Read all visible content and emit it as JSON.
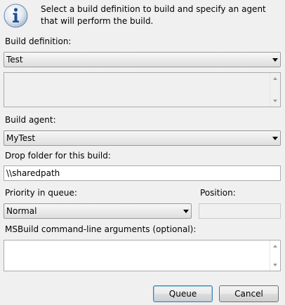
{
  "info": {
    "message": "Select a build definition to build and specify an agent that will perform the build."
  },
  "build_definition": {
    "label": "Build definition:",
    "value": "Test"
  },
  "build_agent": {
    "label": "Build agent:",
    "value": "MyTest"
  },
  "drop_folder": {
    "label": "Drop folder for this build:",
    "value": "\\\\sharedpath"
  },
  "priority": {
    "label": "Priority in queue:",
    "value": "Normal"
  },
  "position": {
    "label": "Position:",
    "value": ""
  },
  "msbuild": {
    "label": "MSBuild command-line arguments (optional):",
    "value": ""
  },
  "buttons": {
    "queue": "Queue",
    "cancel": "Cancel"
  },
  "icons": {
    "info": "info-icon",
    "dropdown": "chevron-down-icon"
  }
}
